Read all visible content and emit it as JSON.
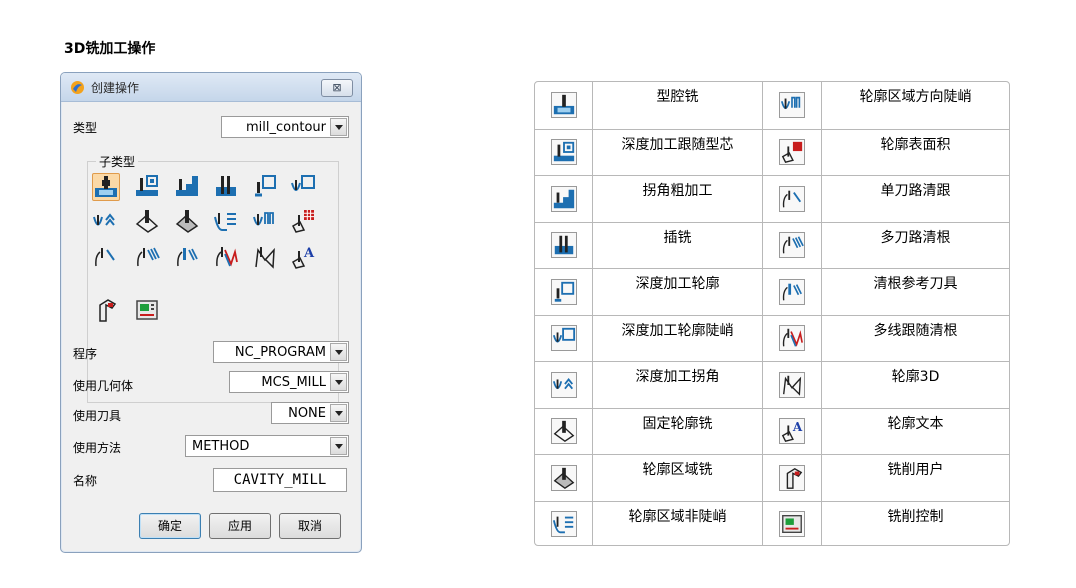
{
  "page_title": "3D铣加工操作",
  "dialog": {
    "title": "创建操作",
    "close_symbol": "⊠",
    "type_label": "类型",
    "type_value": "mill_contour",
    "subtype_caption": "子类型",
    "program_label": "程序",
    "program_value": "NC_PROGRAM",
    "geometry_label": "使用几何体",
    "geometry_value": "MCS_MILL",
    "tool_label": "使用刀具",
    "tool_value": "NONE",
    "method_label": "使用方法",
    "method_value": "METHOD",
    "name_label": "名称",
    "name_value": "CAVITY_MILL",
    "buttons": {
      "ok": "确定",
      "apply": "应用",
      "cancel": "取消"
    },
    "selected_subtype": "型腔铣",
    "subtype_icons": [
      "cavity-mill-icon",
      "zlevel-follow-core-icon",
      "corner-rough-icon",
      "plunge-mill-icon",
      "zlevel-profile-icon",
      "zlevel-profile-steep-icon",
      "zlevel-corner-icon",
      "fixed-contour-icon",
      "contour-area-icon",
      "contour-area-nonsteep-icon",
      "contour-area-dir-steep-icon",
      "contour-surface-area-icon",
      "flowcut-single-icon",
      "flowcut-multiple-icon",
      "flowcut-ref-tool-icon",
      "flowcut-smooth-icon",
      "profile-3d-icon",
      "contour-text-icon",
      "mill-user-icon",
      "mill-control-icon"
    ]
  },
  "table": {
    "rows": [
      {
        "left": "型腔铣",
        "right": "轮廓区域方向陡峭"
      },
      {
        "left": "深度加工跟随型芯",
        "right": "轮廓表面积"
      },
      {
        "left": "拐角粗加工",
        "right": "单刀路清跟"
      },
      {
        "left": "插铣",
        "right": "多刀路清根"
      },
      {
        "left": "深度加工轮廓",
        "right": "清根参考刀具"
      },
      {
        "left": "深度加工轮廓陡峭",
        "right": "多线跟随清根"
      },
      {
        "left": "深度加工拐角",
        "right": "轮廓3D"
      },
      {
        "left": "固定轮廓铣",
        "right": "轮廓文本"
      },
      {
        "left": "轮廓区域铣",
        "right": "铣削用户"
      },
      {
        "left": "轮廓区域非陡峭",
        "right": "铣削控制"
      }
    ]
  }
}
